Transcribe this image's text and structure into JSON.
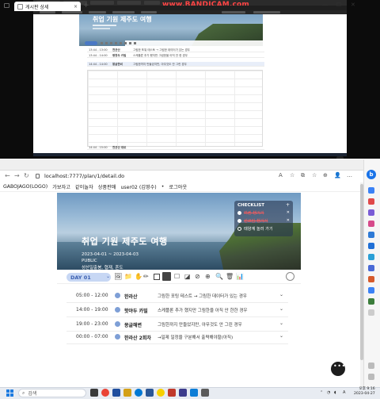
{
  "recording": {
    "watermark": "www.BANDICAM.com",
    "hero_title": "취업 기원 제주도 여행",
    "rows": [
      {
        "time": "13:44 - 13:00",
        "place": "천관산",
        "note": "그림한 포워 테스토 → 그림한 데이터가 있는 경우"
      },
      {
        "time": "13:44 - 14:00",
        "place": "평창두 카빌",
        "note": "스케플론 추가 했지만 그림한을 아직 안 한 경우"
      },
      {
        "time": "14:44 - 14:00",
        "place": "몽글한비",
        "note": "그림한까지 만들었지만, 아무것도 안 그린 경우"
      },
      {
        "time": "14:44 - 15:00",
        "place": "천관산 대로",
        "note": ""
      }
    ]
  },
  "browser": {
    "tab_title": "게시판 상세",
    "tab_close": "×",
    "new_tab": "+",
    "url": "localhost:7777/plan/1/detail.do",
    "nav": {
      "back": "←",
      "forward": "→",
      "refresh": "↻"
    },
    "addr_icons": [
      "A",
      "☆",
      "⧉",
      "☆",
      "⊕",
      "👤",
      "…"
    ],
    "window_controls": {
      "minimize": "—",
      "maximize": "☐",
      "close": "✕"
    },
    "sidebar_badge": "b"
  },
  "site_nav": {
    "logo": "GABOJAGO(LOGO)",
    "items": [
      "가보자고",
      "같이놀자",
      "상품판매",
      "user02 (김영수)",
      "•",
      "로그아웃"
    ]
  },
  "hero": {
    "title": "취업 기원 제주도 여행",
    "dates": "2023-04-01 ~ 2023-04-03",
    "visibility": "PUBLIC",
    "places": "성산일출봉, 협재, 흔도"
  },
  "checklist": {
    "header": "CHECKLIST",
    "add": "+",
    "items": [
      {
        "text": "여권 챙기기",
        "done": true
      },
      {
        "text": "선크림 챙기기",
        "done": true
      },
      {
        "text": "태양계 놀러 가기",
        "done": false
      }
    ],
    "remove": "✕"
  },
  "toolbar": {
    "day_label": "DAY 01",
    "day_arrow": "⌄",
    "tools": [
      "🖼",
      "📁",
      "✋",
      "✏",
      "⤢",
      "◻",
      "◼",
      "☐",
      "◪",
      "⊘",
      "⊕",
      "🔍",
      "🗑",
      "📊"
    ]
  },
  "schedule": [
    {
      "time": "05:00 - 12:00",
      "place": "한라산",
      "note": "그림한 포팅 테스트 → 그림한 데이터가 있는 경우"
    },
    {
      "time": "14:00 - 19:00",
      "place": "핫야두 카빌",
      "note": "스케플론 추가 했지만 그림한을 아직 안 한한 경우"
    },
    {
      "time": "19:00 - 23:00",
      "place": "몽글해변",
      "note": "그림한까지 만들었지만, 아무것도 안 그린 경우"
    },
    {
      "time": "00:00 - 07:00",
      "place": "한라산 2회차",
      "note": "→일제 일정을 구분해서 출력해야할(아직)"
    }
  ],
  "taskbar": {
    "search_placeholder": "검색",
    "time": "오후 9:16",
    "date": "2023-04-27",
    "lang": "A"
  },
  "colors": {
    "accent": "#4a78c4",
    "day_pill_bg": "#c7d7f4",
    "checklist_done": "#ff5b5b",
    "dot": "#7e9fd6"
  }
}
